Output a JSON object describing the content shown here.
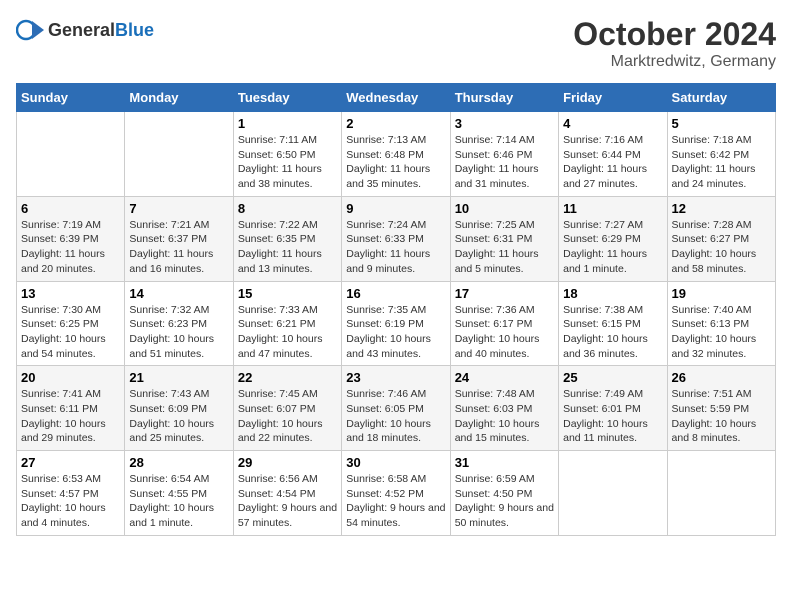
{
  "header": {
    "logo_general": "General",
    "logo_blue": "Blue",
    "month": "October 2024",
    "location": "Marktredwitz, Germany"
  },
  "weekdays": [
    "Sunday",
    "Monday",
    "Tuesday",
    "Wednesday",
    "Thursday",
    "Friday",
    "Saturday"
  ],
  "weeks": [
    [
      {
        "day": "",
        "sunrise": "",
        "sunset": "",
        "daylight": ""
      },
      {
        "day": "",
        "sunrise": "",
        "sunset": "",
        "daylight": ""
      },
      {
        "day": "1",
        "sunrise": "Sunrise: 7:11 AM",
        "sunset": "Sunset: 6:50 PM",
        "daylight": "Daylight: 11 hours and 38 minutes."
      },
      {
        "day": "2",
        "sunrise": "Sunrise: 7:13 AM",
        "sunset": "Sunset: 6:48 PM",
        "daylight": "Daylight: 11 hours and 35 minutes."
      },
      {
        "day": "3",
        "sunrise": "Sunrise: 7:14 AM",
        "sunset": "Sunset: 6:46 PM",
        "daylight": "Daylight: 11 hours and 31 minutes."
      },
      {
        "day": "4",
        "sunrise": "Sunrise: 7:16 AM",
        "sunset": "Sunset: 6:44 PM",
        "daylight": "Daylight: 11 hours and 27 minutes."
      },
      {
        "day": "5",
        "sunrise": "Sunrise: 7:18 AM",
        "sunset": "Sunset: 6:42 PM",
        "daylight": "Daylight: 11 hours and 24 minutes."
      }
    ],
    [
      {
        "day": "6",
        "sunrise": "Sunrise: 7:19 AM",
        "sunset": "Sunset: 6:39 PM",
        "daylight": "Daylight: 11 hours and 20 minutes."
      },
      {
        "day": "7",
        "sunrise": "Sunrise: 7:21 AM",
        "sunset": "Sunset: 6:37 PM",
        "daylight": "Daylight: 11 hours and 16 minutes."
      },
      {
        "day": "8",
        "sunrise": "Sunrise: 7:22 AM",
        "sunset": "Sunset: 6:35 PM",
        "daylight": "Daylight: 11 hours and 13 minutes."
      },
      {
        "day": "9",
        "sunrise": "Sunrise: 7:24 AM",
        "sunset": "Sunset: 6:33 PM",
        "daylight": "Daylight: 11 hours and 9 minutes."
      },
      {
        "day": "10",
        "sunrise": "Sunrise: 7:25 AM",
        "sunset": "Sunset: 6:31 PM",
        "daylight": "Daylight: 11 hours and 5 minutes."
      },
      {
        "day": "11",
        "sunrise": "Sunrise: 7:27 AM",
        "sunset": "Sunset: 6:29 PM",
        "daylight": "Daylight: 11 hours and 1 minute."
      },
      {
        "day": "12",
        "sunrise": "Sunrise: 7:28 AM",
        "sunset": "Sunset: 6:27 PM",
        "daylight": "Daylight: 10 hours and 58 minutes."
      }
    ],
    [
      {
        "day": "13",
        "sunrise": "Sunrise: 7:30 AM",
        "sunset": "Sunset: 6:25 PM",
        "daylight": "Daylight: 10 hours and 54 minutes."
      },
      {
        "day": "14",
        "sunrise": "Sunrise: 7:32 AM",
        "sunset": "Sunset: 6:23 PM",
        "daylight": "Daylight: 10 hours and 51 minutes."
      },
      {
        "day": "15",
        "sunrise": "Sunrise: 7:33 AM",
        "sunset": "Sunset: 6:21 PM",
        "daylight": "Daylight: 10 hours and 47 minutes."
      },
      {
        "day": "16",
        "sunrise": "Sunrise: 7:35 AM",
        "sunset": "Sunset: 6:19 PM",
        "daylight": "Daylight: 10 hours and 43 minutes."
      },
      {
        "day": "17",
        "sunrise": "Sunrise: 7:36 AM",
        "sunset": "Sunset: 6:17 PM",
        "daylight": "Daylight: 10 hours and 40 minutes."
      },
      {
        "day": "18",
        "sunrise": "Sunrise: 7:38 AM",
        "sunset": "Sunset: 6:15 PM",
        "daylight": "Daylight: 10 hours and 36 minutes."
      },
      {
        "day": "19",
        "sunrise": "Sunrise: 7:40 AM",
        "sunset": "Sunset: 6:13 PM",
        "daylight": "Daylight: 10 hours and 32 minutes."
      }
    ],
    [
      {
        "day": "20",
        "sunrise": "Sunrise: 7:41 AM",
        "sunset": "Sunset: 6:11 PM",
        "daylight": "Daylight: 10 hours and 29 minutes."
      },
      {
        "day": "21",
        "sunrise": "Sunrise: 7:43 AM",
        "sunset": "Sunset: 6:09 PM",
        "daylight": "Daylight: 10 hours and 25 minutes."
      },
      {
        "day": "22",
        "sunrise": "Sunrise: 7:45 AM",
        "sunset": "Sunset: 6:07 PM",
        "daylight": "Daylight: 10 hours and 22 minutes."
      },
      {
        "day": "23",
        "sunrise": "Sunrise: 7:46 AM",
        "sunset": "Sunset: 6:05 PM",
        "daylight": "Daylight: 10 hours and 18 minutes."
      },
      {
        "day": "24",
        "sunrise": "Sunrise: 7:48 AM",
        "sunset": "Sunset: 6:03 PM",
        "daylight": "Daylight: 10 hours and 15 minutes."
      },
      {
        "day": "25",
        "sunrise": "Sunrise: 7:49 AM",
        "sunset": "Sunset: 6:01 PM",
        "daylight": "Daylight: 10 hours and 11 minutes."
      },
      {
        "day": "26",
        "sunrise": "Sunrise: 7:51 AM",
        "sunset": "Sunset: 5:59 PM",
        "daylight": "Daylight: 10 hours and 8 minutes."
      }
    ],
    [
      {
        "day": "27",
        "sunrise": "Sunrise: 6:53 AM",
        "sunset": "Sunset: 4:57 PM",
        "daylight": "Daylight: 10 hours and 4 minutes."
      },
      {
        "day": "28",
        "sunrise": "Sunrise: 6:54 AM",
        "sunset": "Sunset: 4:55 PM",
        "daylight": "Daylight: 10 hours and 1 minute."
      },
      {
        "day": "29",
        "sunrise": "Sunrise: 6:56 AM",
        "sunset": "Sunset: 4:54 PM",
        "daylight": "Daylight: 9 hours and 57 minutes."
      },
      {
        "day": "30",
        "sunrise": "Sunrise: 6:58 AM",
        "sunset": "Sunset: 4:52 PM",
        "daylight": "Daylight: 9 hours and 54 minutes."
      },
      {
        "day": "31",
        "sunrise": "Sunrise: 6:59 AM",
        "sunset": "Sunset: 4:50 PM",
        "daylight": "Daylight: 9 hours and 50 minutes."
      },
      {
        "day": "",
        "sunrise": "",
        "sunset": "",
        "daylight": ""
      },
      {
        "day": "",
        "sunrise": "",
        "sunset": "",
        "daylight": ""
      }
    ]
  ]
}
